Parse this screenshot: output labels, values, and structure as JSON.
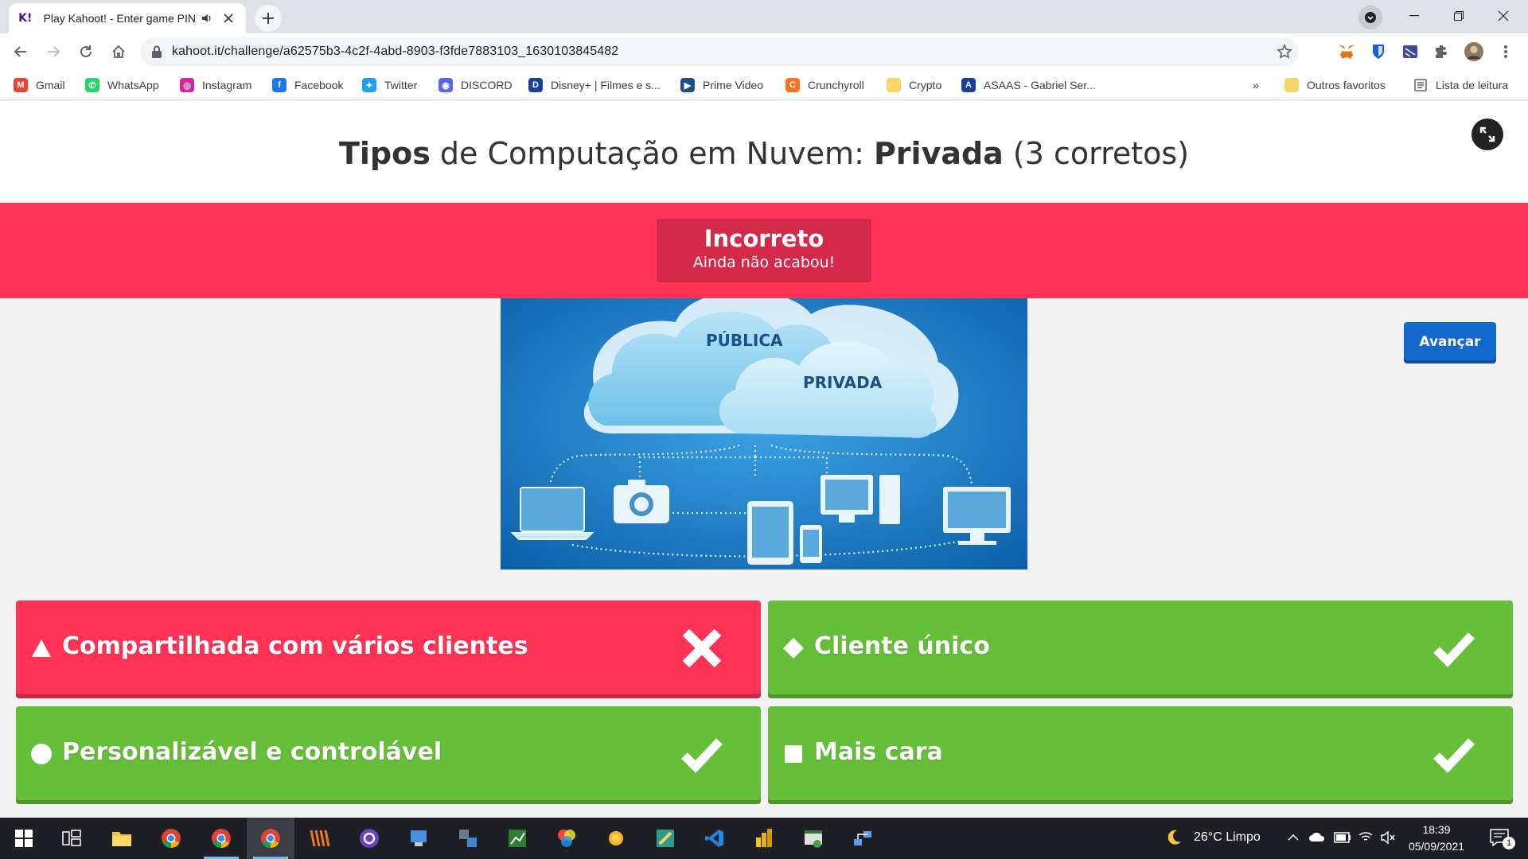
{
  "browser": {
    "tab_title": "Play Kahoot! - Enter game PIN",
    "tab_favicon": "K!",
    "url": "kahoot.it/challenge/a62575b3-4c2f-4abd-8903-f3fde7883103_1630103845482",
    "bookmarks": [
      {
        "label": "Gmail",
        "icon": "gmail-icon",
        "color": "#ea4335",
        "glyph": "M"
      },
      {
        "label": "WhatsApp",
        "icon": "whatsapp-icon",
        "color": "#25d366",
        "glyph": "✆"
      },
      {
        "label": "Instagram",
        "icon": "instagram-icon",
        "color": "#d6249f",
        "glyph": "◎"
      },
      {
        "label": "Facebook",
        "icon": "facebook-icon",
        "color": "#1877f2",
        "glyph": "f"
      },
      {
        "label": "Twitter",
        "icon": "twitter-icon",
        "color": "#1da1f2",
        "glyph": "✦"
      },
      {
        "label": "DISCORD",
        "icon": "discord-icon",
        "color": "#5865f2",
        "glyph": "◉"
      },
      {
        "label": "Disney+ | Filmes e s...",
        "icon": "disney-icon",
        "color": "#1a3e9c",
        "glyph": "D"
      },
      {
        "label": "Prime Video",
        "icon": "prime-video-icon",
        "color": "#1f4f82",
        "glyph": "▶"
      },
      {
        "label": "Crunchyroll",
        "icon": "crunchyroll-icon",
        "color": "#f47521",
        "glyph": "C"
      },
      {
        "label": "Crypto",
        "icon": "folder-icon",
        "color": "#f8d568",
        "glyph": ""
      },
      {
        "label": "ASAAS - Gabriel Ser...",
        "icon": "asaas-icon",
        "color": "#1a3e9c",
        "glyph": "A"
      }
    ],
    "overflow": "»",
    "other_bookmarks": "Outros favoritos",
    "reading_list": "Lista de leitura"
  },
  "question": {
    "title_parts": [
      "Tipos",
      " de Computação em Nuvem: ",
      "Privada",
      " (3 corretos)"
    ]
  },
  "result": {
    "title": "Incorreto",
    "subtitle": "Ainda não acabou!"
  },
  "image": {
    "label_public": "PÚBLICA",
    "label_private": "PRIVADA"
  },
  "next_button": "Avançar",
  "answers": [
    {
      "text": "Compartilhada com vários clientes",
      "shape": "triangle-icon",
      "correct": false,
      "color": "#ff3355"
    },
    {
      "text": "Cliente único",
      "shape": "diamond-icon",
      "correct": true,
      "color": "#66bf39"
    },
    {
      "text": "Personalizável e controlável",
      "shape": "circle-icon",
      "correct": true,
      "color": "#66bf39"
    },
    {
      "text": "Mais cara",
      "shape": "square-icon",
      "correct": true,
      "color": "#66bf39"
    }
  ],
  "taskbar": {
    "weather": "26°C  Limpo",
    "time": "18:39",
    "date": "05/09/2021",
    "notifications": "1"
  }
}
